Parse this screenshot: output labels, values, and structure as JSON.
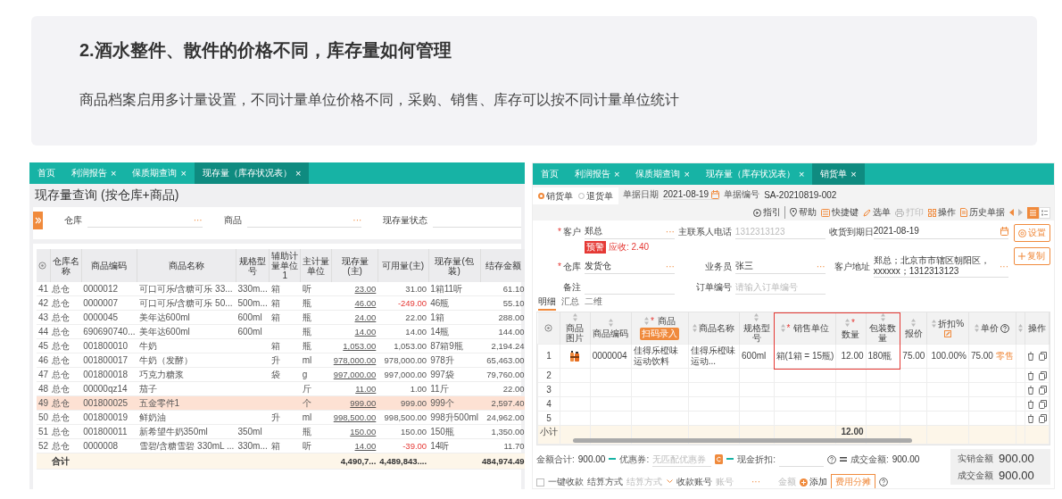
{
  "intro": {
    "title": "2.酒水整件、散件的价格不同，库存量如何管理",
    "text": "商品档案启用多计量设置，不同计量单位价格不同，采购、销售、库存可以按不同计量单位统计"
  },
  "stock": {
    "tabs": [
      {
        "label": "首页",
        "selected": false
      },
      {
        "label": "利润报告",
        "close": "×",
        "selected": false
      },
      {
        "label": "保质期查询",
        "close": "×",
        "selected": false
      },
      {
        "label": "现存量（库存状况表）",
        "close": "×",
        "selected": true
      }
    ],
    "page_title": "现存量查询 (按仓库+商品)",
    "filters": [
      {
        "label": "仓库",
        "more": "···"
      },
      {
        "label": "商品",
        "more": "···"
      },
      {
        "label": "现存量状态"
      }
    ],
    "table": {
      "columns": [
        {
          "kind": "index"
        },
        {
          "label": "仓库名称",
          "kind": "text"
        },
        {
          "label": "商品编码",
          "kind": "text"
        },
        {
          "label": "商品名称",
          "kind": "text"
        },
        {
          "label": "规格型号",
          "kind": "text"
        },
        {
          "label": "辅助计量单位1",
          "kind": "text"
        },
        {
          "label": "主计量单位",
          "kind": "text"
        },
        {
          "label": "现存量(主)",
          "kind": "link"
        },
        {
          "label": "可用量(主)",
          "kind": "number"
        },
        {
          "label": "现存量(包装)",
          "kind": "text"
        },
        {
          "label": "结存金额",
          "kind": "number"
        }
      ],
      "rows": [
        {
          "no": "41",
          "warehouse": "总仓",
          "code": "0000012",
          "name": "可口可乐/含糖可乐 33...",
          "spec": "330m...",
          "aux_unit": "箱",
          "unit": "听",
          "stock": "23.00",
          "available": "31.00",
          "package": "1箱11听",
          "amount": "61.10",
          "selected": false,
          "negative_available": false
        },
        {
          "no": "42",
          "warehouse": "总仓",
          "code": "0000007",
          "name": "可口可乐/含糖可乐 50...",
          "spec": "500m...",
          "aux_unit": "箱",
          "unit": "瓶",
          "stock": "46.00",
          "available": "-249.00",
          "package": "46瓶",
          "amount": "55.10",
          "selected": false,
          "negative_available": true
        },
        {
          "no": "43",
          "warehouse": "总仓",
          "code": "0000045",
          "name": "美年达600ml",
          "spec": "600ml",
          "aux_unit": "箱",
          "unit": "瓶",
          "stock": "24.00",
          "available": "22.00",
          "package": "1箱",
          "amount": "288.00",
          "selected": false,
          "negative_available": false
        },
        {
          "no": "44",
          "warehouse": "总仓",
          "code": "690690740...",
          "name": "美年达600ml",
          "spec": "600ml",
          "unit": "瓶",
          "stock": "14.00",
          "available": "14.00",
          "package": "14瓶",
          "amount": "144.00",
          "selected": false,
          "negative_available": false
        },
        {
          "no": "45",
          "warehouse": "总仓",
          "code": "001800010",
          "name": "牛奶",
          "aux_unit": "箱",
          "unit": "瓶",
          "stock": "1,053.00",
          "available": "1,053.00",
          "package": "87箱9瓶",
          "amount": "2,194.24",
          "selected": false,
          "negative_available": false
        },
        {
          "no": "46",
          "warehouse": "总仓",
          "code": "001800017",
          "name": "牛奶（发酵）",
          "aux_unit": "升",
          "unit": "ml",
          "stock": "978,000.00",
          "available": "978,000.00",
          "package": "978升",
          "amount": "65,463.00",
          "selected": false,
          "negative_available": false
        },
        {
          "no": "47",
          "warehouse": "总仓",
          "code": "001800018",
          "name": "巧克力糖浆",
          "aux_unit": "袋",
          "unit": "g",
          "stock": "997,000.00",
          "available": "997,000.00",
          "package": "997袋",
          "amount": "79,760.00",
          "selected": false,
          "negative_available": false
        },
        {
          "no": "48",
          "warehouse": "总仓",
          "code": "00000qz14",
          "name": "茄子",
          "unit": "斤",
          "stock": "11.00",
          "available": "1.00",
          "package": "11斤",
          "amount": "22.00",
          "selected": false,
          "negative_available": false
        },
        {
          "no": "49",
          "warehouse": "总仓",
          "code": "001800025",
          "name": "五金零件1",
          "unit": "个",
          "stock": "999.00",
          "available": "999.00",
          "package": "999个",
          "amount": "2,597.40",
          "selected": true,
          "negative_available": false
        },
        {
          "no": "50",
          "warehouse": "总仓",
          "code": "001800019",
          "name": "鲜奶油",
          "aux_unit": "升",
          "unit": "ml",
          "stock": "998,500.00",
          "available": "998,500.00",
          "package": "998升500ml",
          "amount": "24,962.00",
          "selected": false,
          "negative_available": false
        },
        {
          "no": "51",
          "warehouse": "总仓",
          "code": "001800011",
          "name": "新希望牛奶350ml",
          "spec": "350ml",
          "unit": "瓶",
          "stock": "150.00",
          "available": "150.00",
          "package": "150瓶",
          "amount": "1,350.00",
          "selected": false,
          "negative_available": false
        },
        {
          "no": "52",
          "warehouse": "总仓",
          "code": "0000008",
          "name": "雪碧/含糖雪碧 330mL ...",
          "spec": "330m...",
          "aux_unit": "箱",
          "unit": "听",
          "stock": "14.00",
          "available": "-39.00",
          "package": "14听",
          "amount": "11.70",
          "selected": false,
          "negative_available": true
        }
      ],
      "total": {
        "warehouse": "合计",
        "stock": "4,490,7...",
        "available": "4,489,843....",
        "amount": "484,974.49"
      }
    }
  },
  "sales": {
    "tabs": [
      {
        "label": "首页",
        "selected": false
      },
      {
        "label": "利润报告",
        "close": "×",
        "selected": false
      },
      {
        "label": "保质期查询",
        "close": "×",
        "selected": false
      },
      {
        "label": "现存量（库存状况表）",
        "close": "×",
        "selected": false
      },
      {
        "label": "销货单",
        "close": "×",
        "selected": true
      }
    ],
    "doc_types": [
      {
        "label": "销货单",
        "selected": true
      },
      {
        "label": "退货单",
        "selected": false
      }
    ],
    "doc_date": {
      "label": "单据日期",
      "value": "2021-08-19"
    },
    "doc_no": {
      "label": "单据编号",
      "value": "SA-20210819-002"
    },
    "toolbar": [
      {
        "label": "指引",
        "disabled": false
      },
      {
        "label": "帮助",
        "disabled": false
      },
      {
        "label": "快捷键",
        "disabled": false
      },
      {
        "label": "选单",
        "disabled": false
      },
      {
        "label": "打印",
        "disabled": true
      },
      {
        "label": "操作",
        "disabled": false
      },
      {
        "label": "历史单据",
        "disabled": false
      }
    ],
    "view_modes": [
      {
        "selected": true
      },
      {
        "selected": false
      }
    ],
    "form_fields": [
      {
        "label": "客户",
        "required_mark": "*",
        "value": "郑总",
        "kind": "picker",
        "more": "···"
      },
      {
        "label": "主联系人电话",
        "placeholder": "1312313123",
        "kind": "text"
      },
      {
        "label": "收货到期日",
        "value": "2021-08-19",
        "kind": "date"
      },
      {
        "label": "仓库",
        "required_mark": "*",
        "value": "发货仓",
        "kind": "picker",
        "more": "···"
      },
      {
        "label": "业务员",
        "value": "张三",
        "kind": "picker",
        "more": "···"
      },
      {
        "label": "客户地址",
        "value": "郑总；北京市市辖区朝阳区，xxxxxx；1312313123",
        "kind": "picker",
        "more": "···"
      },
      {
        "label": "备注",
        "kind": "text"
      },
      {
        "label": "订单编号",
        "placeholder": "请输入订单编号",
        "kind": "text"
      }
    ],
    "credit": {
      "tag": "预警",
      "text": "应收: 2.40"
    },
    "side_buttons": [
      "设置",
      "复制"
    ],
    "detail_tabs": [
      {
        "label": "明细",
        "selected": true
      },
      {
        "label": "汇总",
        "selected": false
      },
      {
        "label": "二维",
        "selected": false
      }
    ],
    "lines": {
      "columns": [
        {
          "kind": "index",
          "sortable": false,
          "highlighted": false
        },
        {
          "label": "商品图片",
          "sortable": true,
          "highlighted": false
        },
        {
          "label": "商品编码",
          "kind": "text",
          "sortable": true,
          "highlighted": false
        },
        {
          "label": "商品",
          "required_mark": "*",
          "extra": {
            "kind": "button",
            "label": "扫码录入"
          },
          "kind": "text",
          "sortable": true,
          "highlighted": false
        },
        {
          "label": "商品名称",
          "kind": "text",
          "sortable": true,
          "highlighted": false
        },
        {
          "label": "规格型号",
          "kind": "text",
          "sortable": true,
          "highlighted": false
        },
        {
          "label": "销售单位",
          "required_mark": "*",
          "kind": "text",
          "sortable": true,
          "highlighted": true
        },
        {
          "label": "数量",
          "required_mark": "*",
          "kind": "number",
          "sortable": true,
          "highlighted": true
        },
        {
          "label": "包装数量",
          "kind": "text",
          "sortable": true,
          "highlighted": true
        },
        {
          "label": "报价",
          "kind": "number",
          "sortable": true,
          "highlighted": false
        },
        {
          "label": "折扣%",
          "extra": {
            "kind": "edit"
          },
          "kind": "number",
          "sortable": true,
          "highlighted": false
        },
        {
          "label": "单价",
          "extra": {
            "kind": "help"
          },
          "kind": "price",
          "sortable": true,
          "highlighted": false
        },
        {
          "kind": "text",
          "sortable": true,
          "highlighted": false
        },
        {
          "label": "操作",
          "kind": "actions",
          "sortable": false,
          "highlighted": false
        }
      ],
      "rows": [
        {
          "no": "1",
          "has_image": true,
          "code": "0000004",
          "product": "佳得乐橙味运动饮料",
          "name": "佳得乐橙味运动...",
          "spec": "600ml",
          "unit": "箱(1箱 = 15瓶)",
          "qty": "12.00",
          "pack_qty": "180瓶",
          "quote": "75.00",
          "discount": "100.00%",
          "price": "75.00",
          "price_tag": "零售"
        },
        {
          "no": "2",
          "has_image": false
        },
        {
          "no": "3",
          "has_image": false
        },
        {
          "no": "4",
          "has_image": false
        },
        {
          "no": "5",
          "has_image": false
        }
      ],
      "subtotal": {
        "no": "小计",
        "qty": "12.00"
      }
    },
    "summary": {
      "total_label": "金额合计:",
      "total": "900.00",
      "coupon_label": "优惠券:",
      "coupon_placeholder": "无匹配优惠券",
      "cash_discount_label": "现金折扣:",
      "deal_label": "成交金额:",
      "deal": "900.00"
    },
    "totals": [
      {
        "label": "实销金额",
        "value": "900.00"
      },
      {
        "label": "成交金额",
        "value": "900.00"
      }
    ],
    "payment": {
      "one_click": {
        "label": "一键收款",
        "checked": false
      },
      "method_label": "结算方式",
      "method_placeholder": "结算方式",
      "account_label": "收款账号",
      "account_placeholder": "账号",
      "account_more": "···",
      "amount_placeholder": "金额",
      "add": "添加",
      "split": "费用分摊"
    }
  }
}
